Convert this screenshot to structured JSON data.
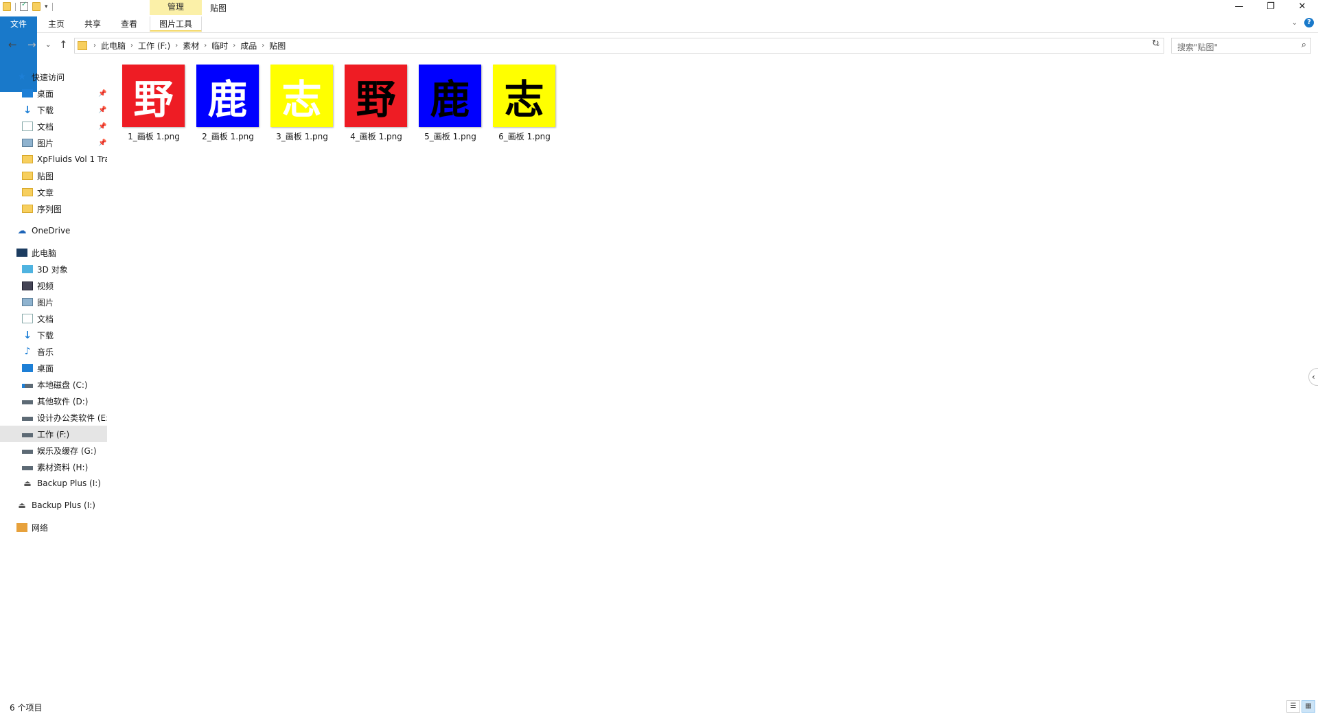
{
  "window": {
    "title": "贴图",
    "contextual_tab": "管理",
    "controls": {
      "minimize": "—",
      "restore": "❐",
      "close": "✕"
    }
  },
  "ribbon": {
    "tabs": [
      {
        "label": "文件"
      },
      {
        "label": "主页"
      },
      {
        "label": "共享"
      },
      {
        "label": "查看"
      },
      {
        "label": "图片工具"
      }
    ],
    "help": "?"
  },
  "address": {
    "crumbs": [
      "此电脑",
      "工作 (F:)",
      "素材",
      "临时",
      "成品",
      "贴图"
    ],
    "search_placeholder": "搜索\"贴图\""
  },
  "sidebar": {
    "quick_access": {
      "label": "快速访问",
      "icon": "star-icon"
    },
    "quick_items": [
      {
        "label": "桌面",
        "icon": "desktop-icon",
        "pinned": true
      },
      {
        "label": "下载",
        "icon": "download-icon",
        "pinned": true
      },
      {
        "label": "文档",
        "icon": "documents-icon",
        "pinned": true
      },
      {
        "label": "图片",
        "icon": "pictures-icon",
        "pinned": true
      },
      {
        "label": "XpFluids Vol 1 Tra",
        "icon": "folder-icon",
        "pinned": false
      },
      {
        "label": "贴图",
        "icon": "folder-icon",
        "pinned": false
      },
      {
        "label": "文章",
        "icon": "folder-icon",
        "pinned": false
      },
      {
        "label": "序列图",
        "icon": "folder-icon",
        "pinned": false
      }
    ],
    "onedrive": {
      "label": "OneDrive",
      "icon": "cloud-icon"
    },
    "this_pc": {
      "label": "此电脑",
      "icon": "pc-icon"
    },
    "pc_items": [
      {
        "label": "3D 对象",
        "icon": "3d-objects-icon"
      },
      {
        "label": "视频",
        "icon": "video-icon"
      },
      {
        "label": "图片",
        "icon": "pictures-icon"
      },
      {
        "label": "文档",
        "icon": "documents-icon"
      },
      {
        "label": "下载",
        "icon": "download-icon"
      },
      {
        "label": "音乐",
        "icon": "music-icon"
      },
      {
        "label": "桌面",
        "icon": "desktop-icon"
      },
      {
        "label": "本地磁盘 (C:)",
        "icon": "system-drive-icon"
      },
      {
        "label": "其他软件 (D:)",
        "icon": "drive-icon"
      },
      {
        "label": "设计办公类软件 (E:",
        "icon": "drive-icon"
      },
      {
        "label": "工作 (F:)",
        "icon": "drive-icon",
        "selected": true
      },
      {
        "label": "娱乐及缓存 (G:)",
        "icon": "drive-icon"
      },
      {
        "label": "素材资料 (H:)",
        "icon": "drive-icon"
      },
      {
        "label": "Backup Plus (I:)",
        "icon": "external-drive-icon"
      }
    ],
    "backup": {
      "label": "Backup Plus (I:)",
      "icon": "external-drive-icon"
    },
    "network": {
      "label": "网络",
      "icon": "network-icon"
    }
  },
  "files": [
    {
      "name": "1_画板 1.png",
      "glyph": "野",
      "bg": "#ee1c24",
      "fg": "#ffffff"
    },
    {
      "name": "2_画板 1.png",
      "glyph": "鹿",
      "bg": "#0000ff",
      "fg": "#ffffff"
    },
    {
      "name": "3_画板 1.png",
      "glyph": "志",
      "bg": "#ffff00",
      "fg": "#ffffff"
    },
    {
      "name": "4_画板 1.png",
      "glyph": "野",
      "bg": "#ee1c24",
      "fg": "#000000"
    },
    {
      "name": "5_画板 1.png",
      "glyph": "鹿",
      "bg": "#0000ff",
      "fg": "#000000"
    },
    {
      "name": "6_画板 1.png",
      "glyph": "志",
      "bg": "#ffff00",
      "fg": "#000000"
    }
  ],
  "status": {
    "count": "6 个项目"
  }
}
